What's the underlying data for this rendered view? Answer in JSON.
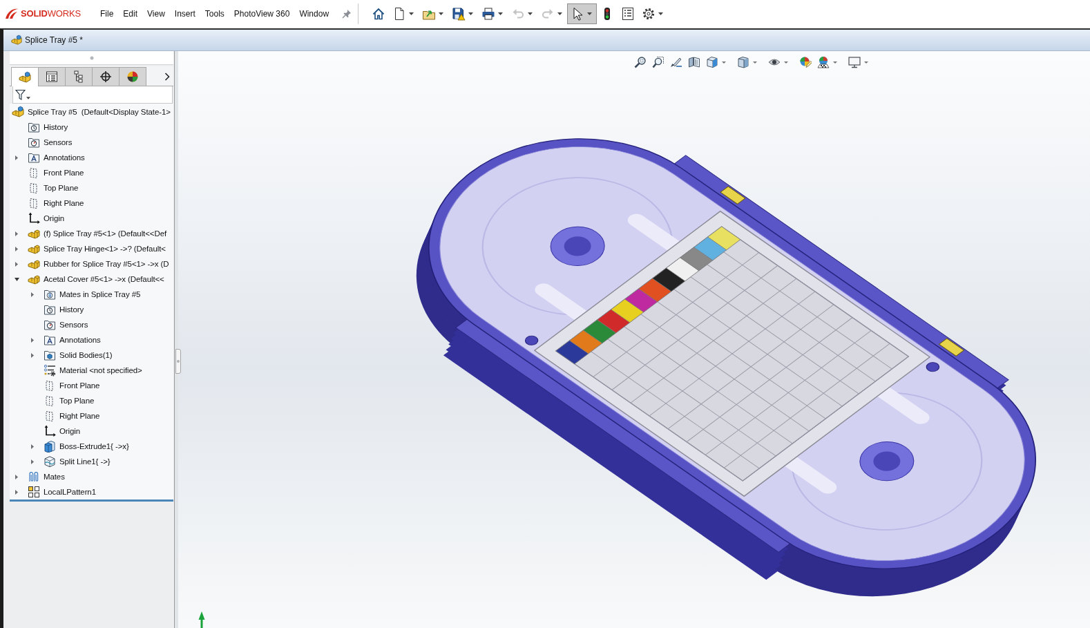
{
  "app": {
    "logo": "**SOLID**WORKS"
  },
  "menu": [
    "File",
    "Edit",
    "View",
    "Insert",
    "Tools",
    "PhotoView 360",
    "Window"
  ],
  "toolbar": [
    {
      "kind": "home",
      "dropdown": false,
      "disabled": false,
      "pressed": false
    },
    {
      "kind": "new",
      "dropdown": true,
      "disabled": false,
      "pressed": false
    },
    {
      "kind": "open",
      "dropdown": true,
      "disabled": false,
      "pressed": false
    },
    {
      "kind": "save",
      "dropdown": true,
      "disabled": false,
      "pressed": false
    },
    {
      "kind": "print",
      "dropdown": true,
      "disabled": false,
      "pressed": false
    },
    {
      "kind": "undo",
      "dropdown": true,
      "disabled": true,
      "pressed": false
    },
    {
      "kind": "redo",
      "dropdown": true,
      "disabled": true,
      "pressed": false
    },
    {
      "kind": "select",
      "dropdown": true,
      "disabled": false,
      "pressed": true
    },
    {
      "kind": "rebuild",
      "dropdown": false,
      "disabled": false,
      "pressed": false
    },
    {
      "kind": "file_properties",
      "dropdown": false,
      "disabled": false,
      "pressed": false
    },
    {
      "kind": "options",
      "dropdown": true,
      "disabled": false,
      "pressed": false
    }
  ],
  "document_tab": {
    "title": "Splice Tray #5 *"
  },
  "panel_tabs": [
    {
      "kind": "feature_manager",
      "selected": true
    },
    {
      "kind": "property_manager",
      "selected": false
    },
    {
      "kind": "configuration_manager",
      "selected": false
    },
    {
      "kind": "dimxpert",
      "selected": false
    },
    {
      "kind": "display_manager",
      "selected": false
    }
  ],
  "feature_tree": {
    "root": {
      "label": "Splice Tray #5  (Default<Display State-1>",
      "kind": "assembly",
      "children": [
        {
          "label": "History",
          "kind": "history"
        },
        {
          "label": "Sensors",
          "kind": "sensors"
        },
        {
          "label": "Annotations",
          "kind": "annotations",
          "expanded": false
        },
        {
          "label": "Front Plane",
          "kind": "plane"
        },
        {
          "label": "Top Plane",
          "kind": "plane"
        },
        {
          "label": "Right Plane",
          "kind": "plane"
        },
        {
          "label": "Origin",
          "kind": "origin"
        },
        {
          "label": "(f) Splice Tray #5<1> (Default<<Def",
          "kind": "part",
          "expanded": false
        },
        {
          "label": "Splice Tray Hinge<1> ->? (Default<",
          "kind": "part",
          "expanded": false
        },
        {
          "label": "Rubber for Splice Tray #5<1> ->x (D",
          "kind": "part",
          "expanded": false
        },
        {
          "label": "Acetal Cover #5<1> ->x (Default<<",
          "kind": "part",
          "expanded": true,
          "children": [
            {
              "label": "Mates in Splice Tray #5",
              "kind": "mates_folder",
              "expanded": false
            },
            {
              "label": "History",
              "kind": "history"
            },
            {
              "label": "Sensors",
              "kind": "sensors"
            },
            {
              "label": "Annotations",
              "kind": "annotations",
              "expanded": false
            },
            {
              "label": "Solid Bodies(1)",
              "kind": "solid_bodies",
              "expanded": false
            },
            {
              "label": "Material <not specified>",
              "kind": "material"
            },
            {
              "label": "Front Plane",
              "kind": "plane"
            },
            {
              "label": "Top Plane",
              "kind": "plane"
            },
            {
              "label": "Right Plane",
              "kind": "plane"
            },
            {
              "label": "Origin",
              "kind": "origin"
            },
            {
              "label": "Boss-Extrude1{ ->x}",
              "kind": "extrude",
              "expanded": false
            },
            {
              "label": "Split Line1{ ->}",
              "kind": "split_line",
              "expanded": false
            }
          ]
        },
        {
          "label": "Mates",
          "kind": "mates",
          "expanded": false
        },
        {
          "label": "LocalLPattern1",
          "kind": "pattern",
          "expanded": false
        }
      ]
    }
  },
  "view_toolbar": [
    {
      "kind": "zoom_fit",
      "dropdown": false
    },
    {
      "kind": "zoom_area",
      "dropdown": false
    },
    {
      "kind": "previous_view",
      "dropdown": false
    },
    {
      "kind": "section_view",
      "dropdown": false
    },
    {
      "kind": "view_orientation",
      "dropdown": true
    },
    {
      "kind": "display_style",
      "dropdown": true
    },
    {
      "kind": "hide_show",
      "dropdown": true
    },
    {
      "kind": "edit_appearance",
      "dropdown": false
    },
    {
      "kind": "apply_scene",
      "dropdown": true
    },
    {
      "kind": "view_settings",
      "dropdown": true
    }
  ]
}
